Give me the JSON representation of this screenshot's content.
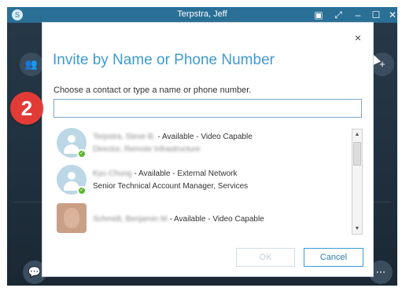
{
  "window": {
    "title": "Terpstra, Jeff",
    "controls": [
      "compact-view",
      "pop-out",
      "minimize",
      "maximize",
      "close"
    ],
    "controls_glyphs": [
      "▣",
      "⤢",
      "–",
      "☐",
      "✕"
    ]
  },
  "step_callout": "2",
  "dialog": {
    "title": "Invite by Name or Phone Number",
    "instruction": "Choose a contact or type a name or phone number.",
    "search_value": "",
    "close_glyph": "×",
    "ok_label": "OK",
    "cancel_label": "Cancel",
    "contacts": [
      {
        "name": "Terpstra, Steve B.",
        "presence": "- Available - Video Capable",
        "subtitle": "Director, Remote Infrastructure",
        "avatar": "person-icon",
        "status": "available",
        "subtitle_obscured": true
      },
      {
        "name": "Kyu Chung",
        "presence": "- Available - External Network",
        "subtitle": "Senior Technical Account Manager, Services",
        "avatar": "person-icon",
        "status": "available",
        "subtitle_obscured": false
      },
      {
        "name": "Schmidt, Benjamin M",
        "presence": "- Available - Video Capable",
        "subtitle": "",
        "avatar": "photo",
        "status": "available",
        "subtitle_obscured": false
      }
    ]
  },
  "colors": {
    "accent": "#3d9ad2",
    "titlebar": "#2a6f95",
    "available": "#5cb531",
    "step": "#e23b36"
  }
}
